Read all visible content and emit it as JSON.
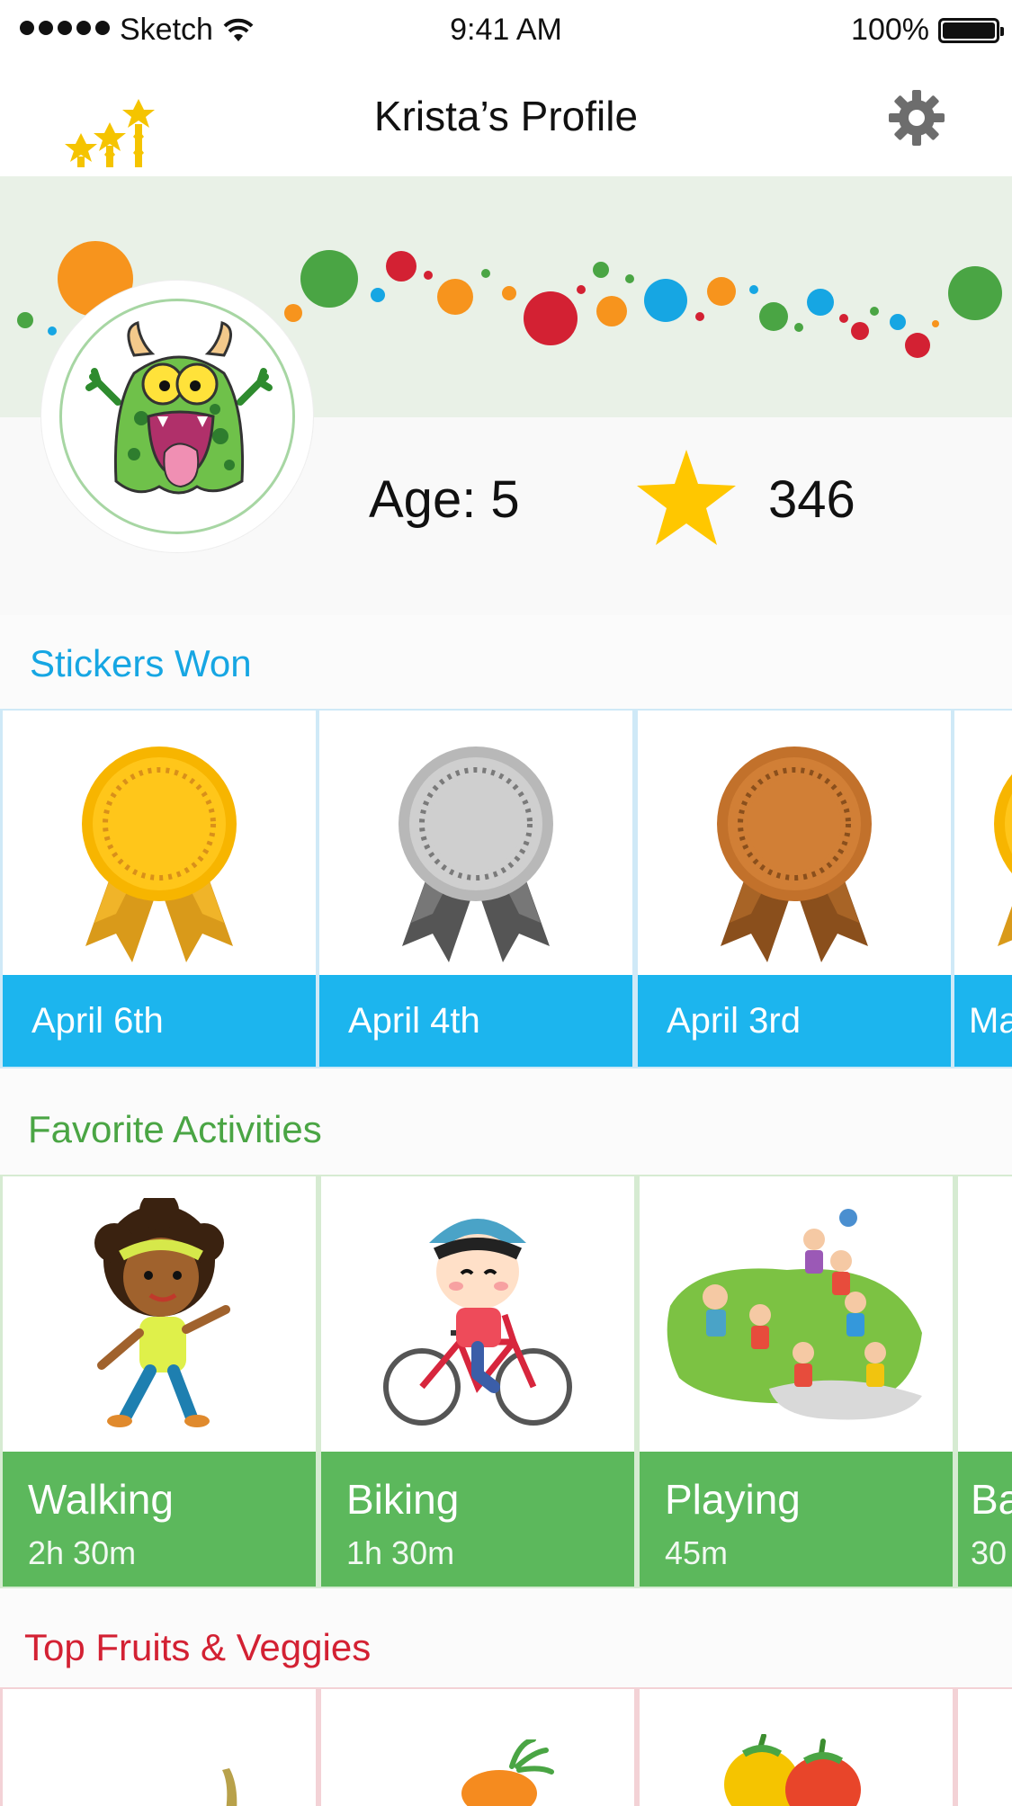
{
  "status_bar": {
    "carrier": "Sketch",
    "time": "9:41 AM",
    "battery": "100%"
  },
  "nav": {
    "title": "Krista’s Profile",
    "left_icon": "leaderboard-stars-icon",
    "right_icon": "gear-icon"
  },
  "profile": {
    "age_text": "Age: 5",
    "points": "346",
    "avatar": "monster-avatar"
  },
  "stickers": {
    "title": "Stickers Won",
    "items": [
      {
        "label": "April 6th",
        "medal": "gold"
      },
      {
        "label": "April 4th",
        "medal": "silver"
      },
      {
        "label": "April 3rd",
        "medal": "bronze"
      },
      {
        "label": "Ma",
        "medal": "gold"
      }
    ]
  },
  "activities": {
    "title": "Favorite Activities",
    "items": [
      {
        "name": "Walking",
        "time": "2h 30m",
        "image": "walking-girl"
      },
      {
        "name": "Biking",
        "time": "1h 30m",
        "image": "biking-girl"
      },
      {
        "name": "Playing",
        "time": "45m",
        "image": "kids-playing"
      },
      {
        "name": "Ba",
        "time": "30",
        "image": "partial"
      }
    ]
  },
  "fruits": {
    "title": "Top Fruits & Veggies",
    "items": [
      "banana",
      "carrot",
      "peppers",
      "partial"
    ]
  },
  "colors": {
    "sticker_label_bg": "#1cb5ee",
    "activity_label_bg": "#5cb85c",
    "stickers_title": "#16a6e3",
    "activities_title": "#4aa544",
    "fruits_title": "#d32133",
    "star": "#ffc700"
  }
}
